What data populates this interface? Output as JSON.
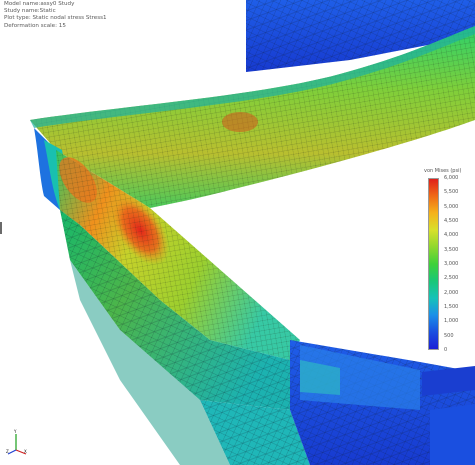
{
  "info": {
    "lines": [
      "Model name:assy0 Study",
      "Study name:Static",
      "Plot type: Static nodal stress Stress1",
      "Deformation scale: 15"
    ]
  },
  "legend": {
    "title": "von Mises (psi)",
    "ticks": [
      "6,000",
      "5,500",
      "5,000",
      "4,500",
      "4,000",
      "3,500",
      "3,000",
      "2,500",
      "2,000",
      "1,500",
      "1,000",
      "500",
      "0"
    ],
    "colors": [
      "#e0201a",
      "#ef6a17",
      "#f5b21b",
      "#d8e02a",
      "#8fd82d",
      "#3fd13a",
      "#19c777",
      "#16c2b8",
      "#1b8fe8",
      "#1a4fe0",
      "#1a1fd6"
    ]
  },
  "triad": {
    "x_label": "X",
    "y_label": "Y",
    "z_label": "Z"
  }
}
